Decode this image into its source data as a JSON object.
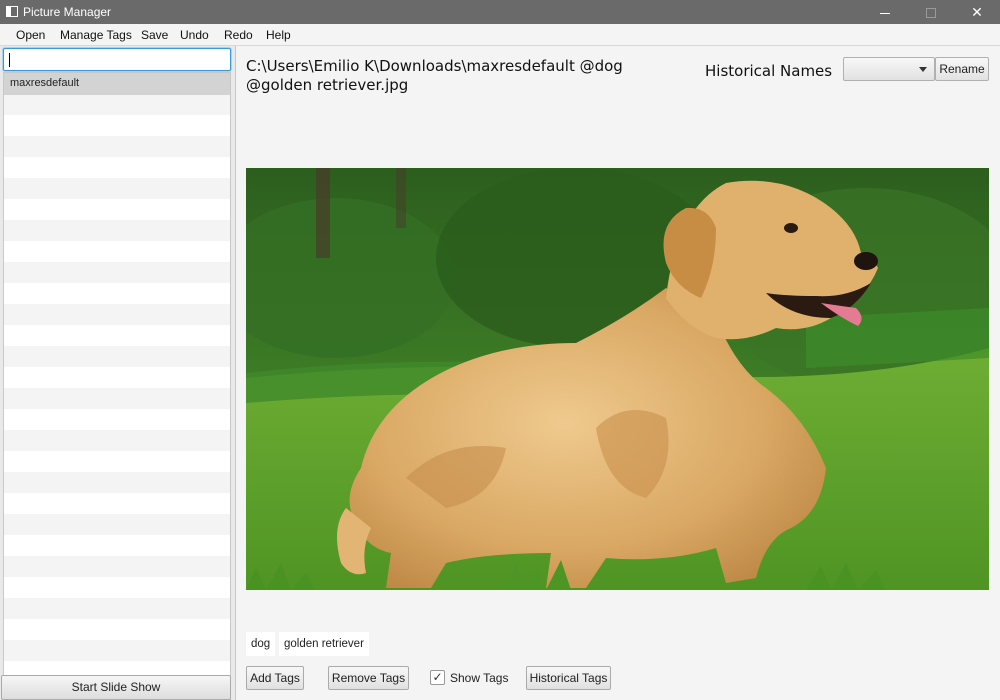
{
  "window": {
    "title": "Picture Manager",
    "minimize_icon": "minimize-icon",
    "maximize_icon": "maximize-icon",
    "close_icon": "close-icon",
    "close_glyph": "✕"
  },
  "menu": [
    "Open",
    "Manage Tags",
    "Save",
    "Undo",
    "Redo",
    "Help"
  ],
  "sidebar": {
    "search_value": "",
    "files": [
      "maxresdefault"
    ],
    "slideshow_label": "Start Slide Show"
  },
  "main": {
    "path_line1": "C:\\Users\\Emilio K\\Downloads\\maxresdefault @dog",
    "path_line2": "@golden retriever.jpg",
    "historical_names_label": "Historical Names",
    "historical_select_value": "",
    "rename_label": "Rename",
    "tags": [
      "dog",
      "golden retriever"
    ],
    "add_tags_label": "Add Tags",
    "remove_tags_label": "Remove Tags",
    "show_tags_label": "Show Tags",
    "show_tags_checked": true,
    "check_glyph": "✓",
    "historical_tags_label": "Historical Tags"
  },
  "colors": {
    "titlebar": "#6a6a6a",
    "selection": "#d3d3d3",
    "focus": "#3a9ad9",
    "grass": "#5a9a2e",
    "forest": "#2f6a22",
    "dog": "#d9a966"
  }
}
